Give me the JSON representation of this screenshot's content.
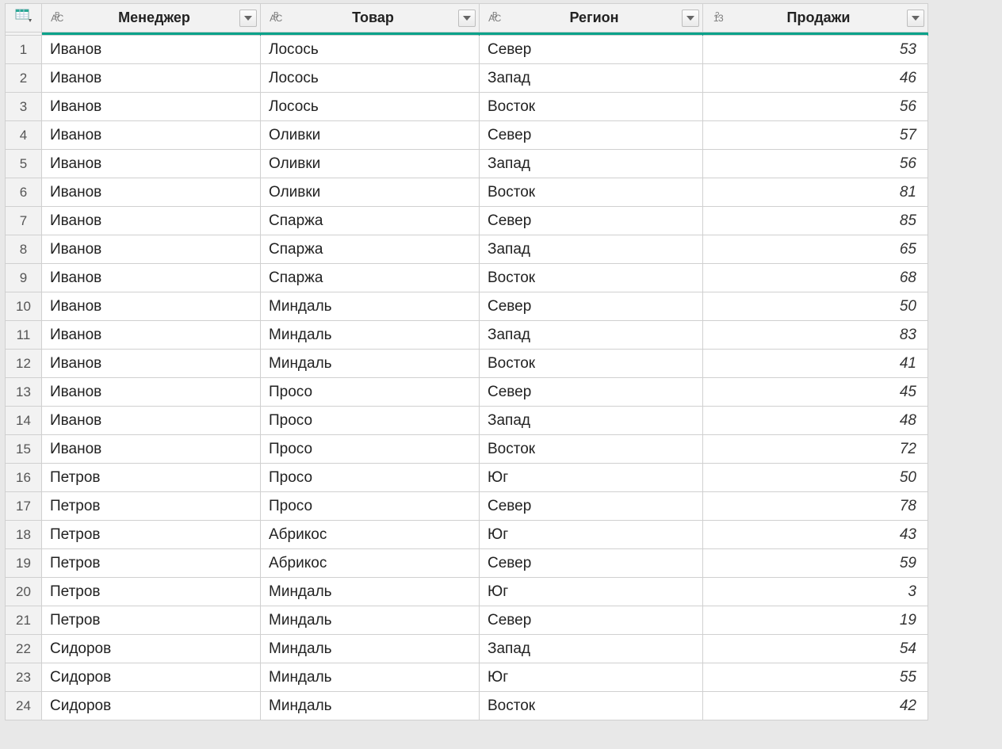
{
  "columns": [
    {
      "name": "Менеджер",
      "type": "abc"
    },
    {
      "name": "Товар",
      "type": "abc"
    },
    {
      "name": "Регион",
      "type": "abc"
    },
    {
      "name": "Продажи",
      "type": "num"
    }
  ],
  "rows": [
    {
      "n": 1,
      "m": "Иванов",
      "t": "Лосось",
      "r": "Север",
      "s": 53
    },
    {
      "n": 2,
      "m": "Иванов",
      "t": "Лосось",
      "r": "Запад",
      "s": 46
    },
    {
      "n": 3,
      "m": "Иванов",
      "t": "Лосось",
      "r": "Восток",
      "s": 56
    },
    {
      "n": 4,
      "m": "Иванов",
      "t": "Оливки",
      "r": "Север",
      "s": 57
    },
    {
      "n": 5,
      "m": "Иванов",
      "t": "Оливки",
      "r": "Запад",
      "s": 56
    },
    {
      "n": 6,
      "m": "Иванов",
      "t": "Оливки",
      "r": "Восток",
      "s": 81
    },
    {
      "n": 7,
      "m": "Иванов",
      "t": "Спаржа",
      "r": "Север",
      "s": 85
    },
    {
      "n": 8,
      "m": "Иванов",
      "t": "Спаржа",
      "r": "Запад",
      "s": 65
    },
    {
      "n": 9,
      "m": "Иванов",
      "t": "Спаржа",
      "r": "Восток",
      "s": 68
    },
    {
      "n": 10,
      "m": "Иванов",
      "t": "Миндаль",
      "r": "Север",
      "s": 50
    },
    {
      "n": 11,
      "m": "Иванов",
      "t": "Миндаль",
      "r": "Запад",
      "s": 83
    },
    {
      "n": 12,
      "m": "Иванов",
      "t": "Миндаль",
      "r": "Восток",
      "s": 41
    },
    {
      "n": 13,
      "m": "Иванов",
      "t": "Просо",
      "r": "Север",
      "s": 45
    },
    {
      "n": 14,
      "m": "Иванов",
      "t": "Просо",
      "r": "Запад",
      "s": 48
    },
    {
      "n": 15,
      "m": "Иванов",
      "t": "Просо",
      "r": "Восток",
      "s": 72
    },
    {
      "n": 16,
      "m": "Петров",
      "t": "Просо",
      "r": "Юг",
      "s": 50
    },
    {
      "n": 17,
      "m": "Петров",
      "t": "Просо",
      "r": "Север",
      "s": 78
    },
    {
      "n": 18,
      "m": "Петров",
      "t": "Абрикос",
      "r": "Юг",
      "s": 43
    },
    {
      "n": 19,
      "m": "Петров",
      "t": "Абрикос",
      "r": "Север",
      "s": 59
    },
    {
      "n": 20,
      "m": "Петров",
      "t": "Миндаль",
      "r": "Юг",
      "s": 3
    },
    {
      "n": 21,
      "m": "Петров",
      "t": "Миндаль",
      "r": "Север",
      "s": 19
    },
    {
      "n": 22,
      "m": "Сидоров",
      "t": "Миндаль",
      "r": "Запад",
      "s": 54
    },
    {
      "n": 23,
      "m": "Сидоров",
      "t": "Миндаль",
      "r": "Юг",
      "s": 55
    },
    {
      "n": 24,
      "m": "Сидоров",
      "t": "Миндаль",
      "r": "Восток",
      "s": 42
    }
  ]
}
